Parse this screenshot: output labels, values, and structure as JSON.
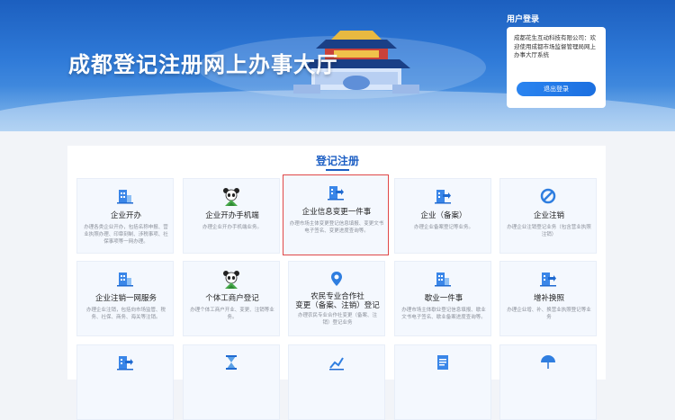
{
  "header": {
    "title": "成都登记注册网上办事大厅"
  },
  "login": {
    "title": "用户登录",
    "message": "成都花生互动科技有限公司：欢迎使用成都市场监督管理局网上办事大厅系统",
    "logout_label": "退出登录"
  },
  "section": {
    "title": "登记注册"
  },
  "cards": [
    {
      "title": "企业开办",
      "desc": "办理各类企业开办，包括名称申报、营业执照办理、印章刻制、涉税事项、社保事项等一网办理。",
      "icon": "building-icon"
    },
    {
      "title": "企业开办手机端",
      "desc": "办理企业开办手机端业务。",
      "icon": "panda-icon"
    },
    {
      "title": "企业信息变更一件事",
      "desc": "办理市场主体变更登记信息填报、变更文书电子签名、变更进度查询等。",
      "icon": "building-arrow-icon"
    },
    {
      "title": "企业（备案）",
      "desc": "办理企业备案登记等业务。",
      "icon": "building-arrow-icon"
    },
    {
      "title": "企业注销",
      "desc": "办理企业注销登记业务（包含营业执照注销）",
      "icon": "prohibit-icon"
    },
    {
      "title": "企业注销一网服务",
      "desc": "办理企业注销，包括向市场监管、税务、社保、商务、海关等注销。",
      "icon": "building-icon"
    },
    {
      "title": "个体工商户登记",
      "desc": "办理个体工商户开业、变更、注销等业务。",
      "icon": "panda-icon"
    },
    {
      "title": "农民专业合作社\n变更（备案、注销）登记",
      "desc": "办理农民专业合作社变更（备案、注销）登记业务",
      "icon": "pin-icon"
    },
    {
      "title": "歇业一件事",
      "desc": "办理市场主体歇业登记信息填报、歇业文书电子签名、歇业备案进度查询等。",
      "icon": "building-icon"
    },
    {
      "title": "增补换照",
      "desc": "办理企业增、补、换营业执照登记等业务",
      "icon": "building-arrow-icon"
    },
    {
      "title": "",
      "desc": "",
      "icon": "building-arrow-icon"
    },
    {
      "title": "",
      "desc": "",
      "icon": "hourglass-icon"
    },
    {
      "title": "",
      "desc": "",
      "icon": "chart-icon"
    },
    {
      "title": "",
      "desc": "",
      "icon": "document-icon"
    },
    {
      "title": "",
      "desc": "",
      "icon": "umbrella-icon"
    }
  ],
  "colors": {
    "accent": "#1d5fc4",
    "banner": "#2f7ad8",
    "highlight": "#e04848"
  }
}
